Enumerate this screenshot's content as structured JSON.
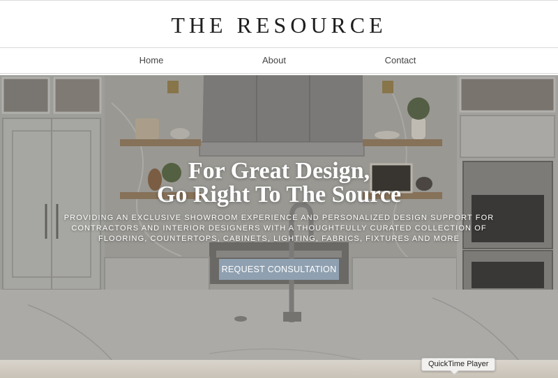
{
  "site": {
    "logo": "THE RESOURCE"
  },
  "nav": {
    "home": "Home",
    "about": "About",
    "contact": "Contact"
  },
  "hero": {
    "headline_line1": "For Great Design,",
    "headline_line2": "Go Right To The Source",
    "subtext": "Providing an exclusive showroom experience and personalized design support for contractors and interior designers with a thoughtfully curated collection of flooring, countertops, cabinets, lighting, fabrics, fixtures and more",
    "cta_label": "REQUEST CONSULTATION"
  },
  "tooltip": {
    "label": "QuickTime Player"
  },
  "colors": {
    "cta": "#8fa0b1",
    "text_dark": "#1e1e1e",
    "nav_text": "#444444"
  }
}
